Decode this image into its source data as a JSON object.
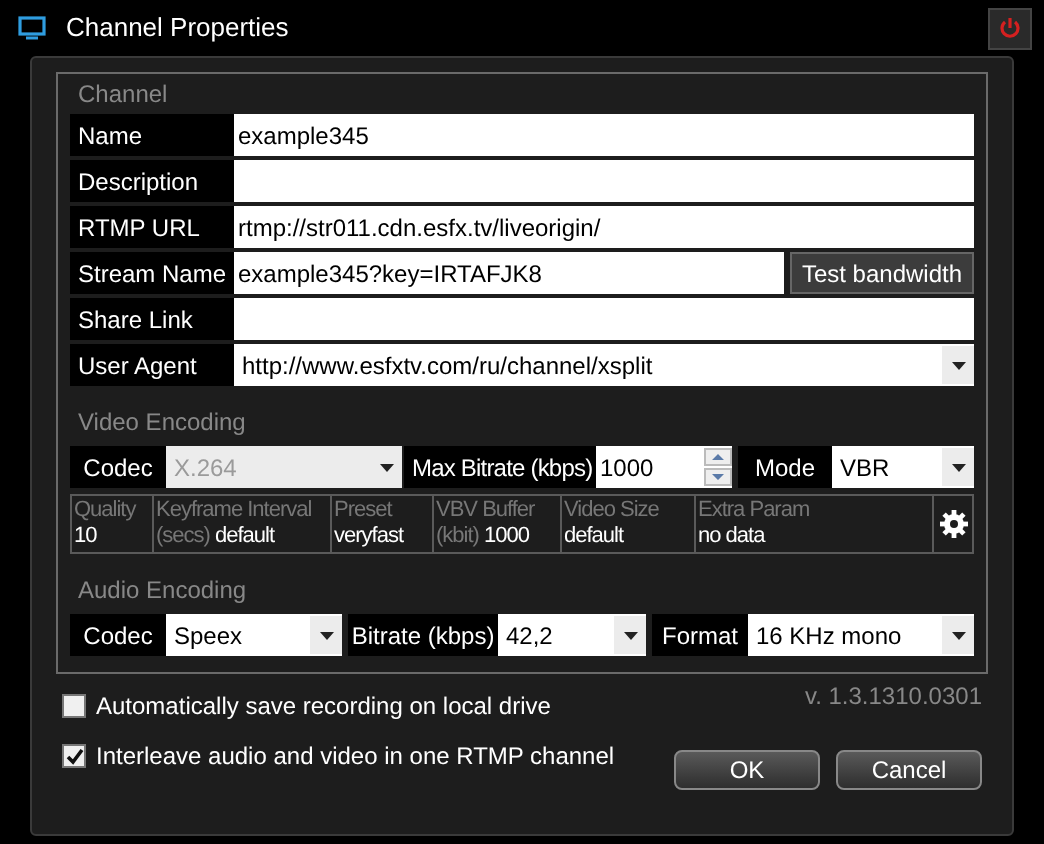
{
  "window": {
    "title": "Channel Properties"
  },
  "channel": {
    "title": "Channel",
    "fields": [
      {
        "kind": "text",
        "label": "Name",
        "value": "example345"
      },
      {
        "kind": "text",
        "label": "Description"
      },
      {
        "kind": "text",
        "label": "RTMP URL",
        "value": "rtmp://str011.cdn.esfx.tv/liveorigin/"
      },
      {
        "kind": "button",
        "label": "Stream Name",
        "value": "example345?key=IRTAFJK8",
        "button": "Test bandwidth"
      },
      {
        "kind": "text",
        "label": "Share Link"
      },
      {
        "kind": "dropdown",
        "label": "User Agent",
        "value": "http://www.esfxtv.com/ru/channel/xsplit"
      }
    ]
  },
  "video": {
    "title": "Video Encoding",
    "codec": {
      "label": "Codec",
      "value": "X.264",
      "disabled": true
    },
    "max_bitrate": {
      "label": "Max Bitrate (kbps)",
      "value": "1000"
    },
    "mode": {
      "label": "Mode",
      "value": "VBR"
    },
    "params": [
      {
        "label": "Quality",
        "value": "10"
      },
      {
        "label": "Keyframe Interval",
        "unit": "(secs)",
        "value": "default"
      },
      {
        "label": "Preset",
        "value": "veryfast"
      },
      {
        "label": "VBV Buffer",
        "unit": "(kbit)",
        "value": "1000"
      },
      {
        "label": "Video Size",
        "value": "default"
      },
      {
        "label": "Extra Param",
        "value": "no data"
      }
    ]
  },
  "audio": {
    "title": "Audio Encoding",
    "fields": [
      {
        "label": "Codec",
        "value": "Speex"
      },
      {
        "label": "Bitrate (kbps)",
        "value": "42,2"
      },
      {
        "label": "Format",
        "value": "16 KHz mono"
      }
    ]
  },
  "version": "v. 1.3.1310.0301",
  "options": [
    {
      "label": "Automatically save recording on local drive",
      "checked": false
    },
    {
      "label": "Interleave audio and video in one RTMP channel",
      "checked": true
    }
  ],
  "buttons": [
    "OK",
    "Cancel"
  ]
}
